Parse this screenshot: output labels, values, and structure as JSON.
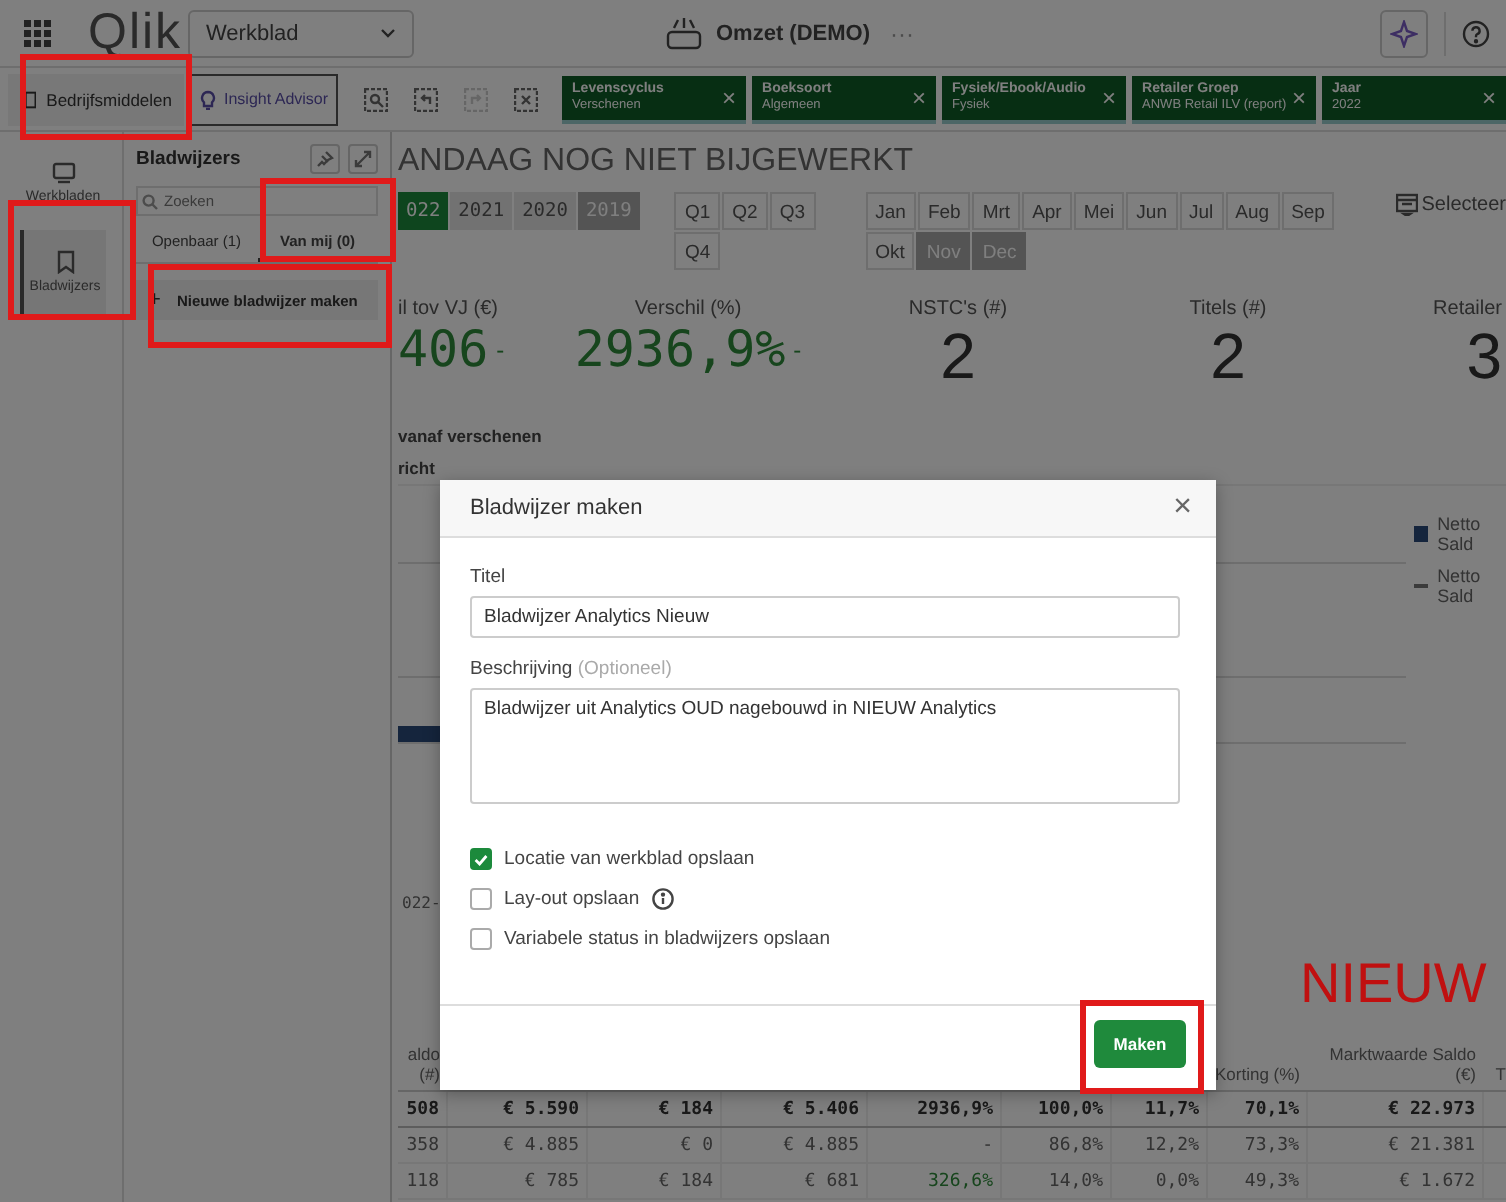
{
  "top_bar": {
    "logo": "Qlik",
    "sheet_dropdown": "Werkblad",
    "app_title": "Omzet (DEMO)",
    "more": "···"
  },
  "toolbar": {
    "assets_button": "Bedrijfsmiddelen",
    "insight_button": "Insight Advisor",
    "filters": [
      {
        "field": "Levenscyclus",
        "value": "Verschenen",
        "remove": "×"
      },
      {
        "field": "Boeksoort",
        "value": "Algemeen",
        "remove": "×"
      },
      {
        "field": "Fysiek/Ebook/Audio",
        "value": "Fysiek",
        "remove": "×"
      },
      {
        "field": "Retailer Groep",
        "value": "ANWB Retail ILV (report)",
        "remove": "×"
      },
      {
        "field": "Jaar",
        "value": "2022",
        "remove": "×"
      }
    ]
  },
  "rail": [
    {
      "label": "Werkbladen",
      "kind": "sheets",
      "selected": false
    },
    {
      "label": "Bladwijzers",
      "kind": "bookmarks",
      "selected": true
    }
  ],
  "bookmarks_panel": {
    "title": "Bladwijzers",
    "search": {
      "placeholder": "Zoeken"
    },
    "tabs": [
      {
        "label": "Openbaar (1)",
        "selected": false
      },
      {
        "label": "Van mij (0)",
        "selected": true
      }
    ],
    "new_icon": "+",
    "new_button": "Nieuwe bladwijzer maken"
  },
  "sheet": {
    "title": "ANDAAG NOG NIET BIJGEWERKT",
    "years": [
      {
        "label": "022",
        "selected": true,
        "excluded": false,
        "alternative": false
      },
      {
        "label": "2021",
        "selected": false,
        "excluded": false,
        "alternative": true
      },
      {
        "label": "2020",
        "selected": false,
        "excluded": false,
        "alternative": true
      },
      {
        "label": "2019",
        "selected": false,
        "excluded": true,
        "alternative": false
      }
    ],
    "quarters": [
      {
        "label": "Q1",
        "selected": false,
        "excluded": false
      },
      {
        "label": "Q2",
        "selected": false,
        "excluded": false
      },
      {
        "label": "Q3",
        "selected": false,
        "excluded": false
      },
      {
        "label": "Q4",
        "selected": false,
        "excluded": false
      }
    ],
    "months": [
      {
        "label": "Jan",
        "selected": false,
        "excluded": false
      },
      {
        "label": "Feb",
        "selected": false,
        "excluded": false
      },
      {
        "label": "Mrt",
        "selected": false,
        "excluded": false
      },
      {
        "label": "Apr",
        "selected": false,
        "excluded": false
      },
      {
        "label": "Mei",
        "selected": false,
        "excluded": false
      },
      {
        "label": "Jun",
        "selected": false,
        "excluded": false
      },
      {
        "label": "Jul",
        "selected": false,
        "excluded": false
      },
      {
        "label": "Aug",
        "selected": false,
        "excluded": false
      },
      {
        "label": "Sep",
        "selected": false,
        "excluded": false
      },
      {
        "label": "Okt",
        "selected": false,
        "excluded": false
      },
      {
        "label": "Nov",
        "selected": false,
        "excluded": true
      },
      {
        "label": "Dec",
        "selected": false,
        "excluded": true
      }
    ],
    "select_button": "Selecteer",
    "kpis": [
      {
        "label": "il tov VJ (€)",
        "value": "406",
        "trend": "-",
        "positive": true
      },
      {
        "label": "Verschil (%)",
        "value": "2936,9%",
        "trend": "-",
        "positive": true
      },
      {
        "label": "NSTC's (#)",
        "value": "2",
        "positive": false
      },
      {
        "label": "Titels (#)",
        "value": "2",
        "positive": false
      },
      {
        "label": "Retailer",
        "value": "3",
        "positive": false
      }
    ],
    "chart_title": "vanaf verschenen",
    "chart_subtitle": "richt",
    "axis_label": "022-",
    "legend": [
      {
        "label": "Netto Sald",
        "kind": "bar"
      },
      {
        "label": "Netto Sald",
        "kind": "line"
      }
    ],
    "table": {
      "columns": [
        {
          "header": "aldo (#)"
        },
        {},
        {},
        {},
        {},
        {},
        {},
        {
          "header": "Korting (%)"
        },
        {
          "header": "Marktwaarde Saldo (€)"
        },
        {
          "header": "T"
        }
      ],
      "rows": [
        {
          "total": true,
          "cells": [
            "508",
            "€ 5.590",
            "€ 184",
            "€ 5.406",
            "2936,9%",
            "100,0%",
            "11,7%",
            "70,1%",
            "€ 22.973"
          ]
        },
        {
          "total": false,
          "cells": [
            "358",
            "€ 4.885",
            "€ 0",
            "€ 4.885",
            "-",
            "86,8%",
            "12,2%",
            "73,3%",
            "€ 21.381"
          ]
        },
        {
          "total": false,
          "cells": [
            "118",
            "€ 785",
            "€ 184",
            "€ 681",
            {
              "text": "326,6%",
              "positive": true
            },
            "14,0%",
            "0,0%",
            "49,3%",
            "€ 1.672"
          ]
        }
      ]
    }
  },
  "dialog": {
    "title": "Bladwijzer maken",
    "close": "×",
    "fields": [
      {
        "kind": "input",
        "label": "Titel",
        "value": "Bladwijzer Analytics Nieuw"
      },
      {
        "kind": "textarea",
        "label": "Beschrijving",
        "hint": "(Optioneel)",
        "value": "Bladwijzer uit Analytics OUD nagebouwd in NIEUW Analytics"
      }
    ],
    "options": [
      {
        "label": "Locatie van werkblad opslaan",
        "checked": true,
        "info": false
      },
      {
        "label": "Lay-out opslaan",
        "checked": false,
        "info": true
      },
      {
        "label": "Variabele status in bladwijzers opslaan",
        "checked": false,
        "info": false
      }
    ],
    "submit": "Maken"
  },
  "annotation": {
    "label": "NIEUW"
  }
}
